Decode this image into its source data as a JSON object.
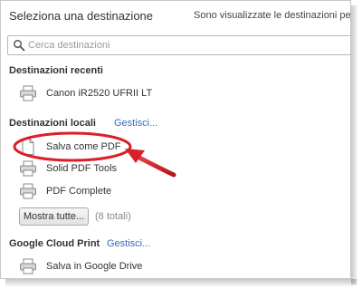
{
  "header": {
    "title": "Seleziona una destinazione",
    "hint": "Sono visualizzate le destinazioni per andrea"
  },
  "search": {
    "placeholder": "Cerca destinazioni",
    "icon": "search-icon"
  },
  "recent": {
    "title": "Destinazioni recenti",
    "items": [
      {
        "label": "Canon iR2520 UFRII LT",
        "icon": "printer-icon"
      }
    ]
  },
  "local": {
    "title": "Destinazioni locali",
    "manage_label": "Gestisci...",
    "items": [
      {
        "label": "Salva come PDF",
        "icon": "document-icon"
      },
      {
        "label": "Solid PDF Tools",
        "icon": "printer-icon"
      },
      {
        "label": "PDF Complete",
        "icon": "printer-icon"
      }
    ],
    "show_all_label": "Mostra tutte...",
    "total_count": "(8 totali)"
  },
  "cloud": {
    "title": "Google Cloud Print",
    "manage_label": "Gestisci...",
    "items": [
      {
        "label": "Salva in Google Drive",
        "icon": "printer-icon"
      }
    ]
  },
  "colors": {
    "link": "#3a6ab9",
    "annotation": "#d9202a"
  }
}
